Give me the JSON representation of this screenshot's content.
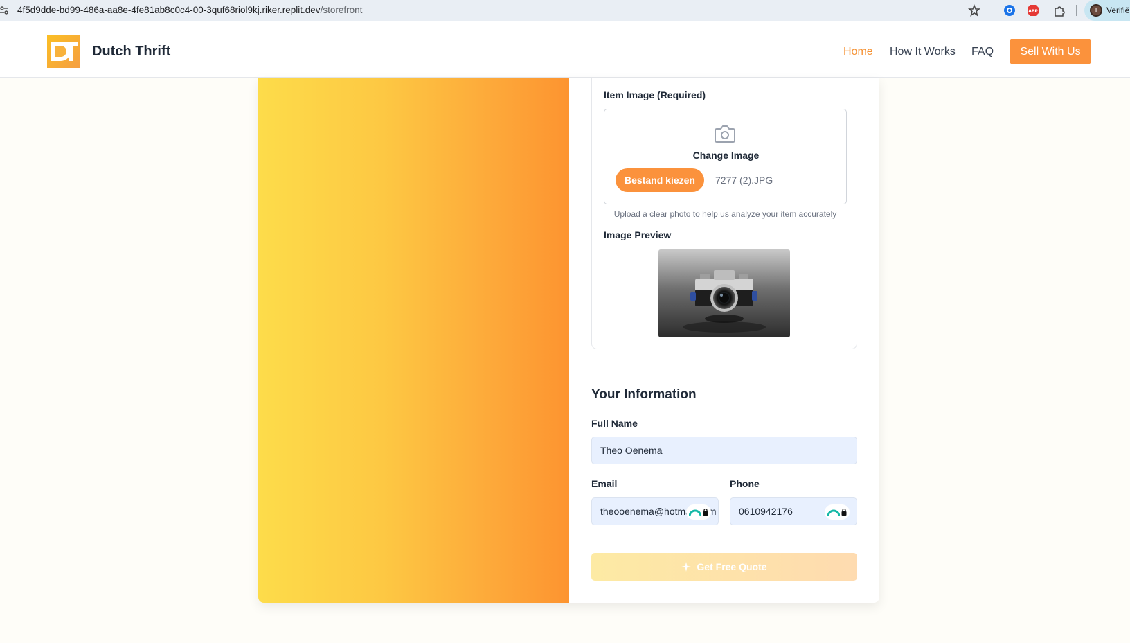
{
  "browser": {
    "url_host": "4f5d9dde-bd99-486a-aa8e-4fe81ab8c0c4-00-3quf68riol9kj.riker.replit.dev",
    "url_path": "/storefront",
    "profile_initial": "T",
    "profile_label": "Verifië"
  },
  "header": {
    "logo_text": "DT",
    "brand": "Dutch Thrift",
    "nav": {
      "home": "Home",
      "how": "How It Works",
      "faq": "FAQ"
    },
    "cta": "Sell With Us"
  },
  "form": {
    "image_label": "Item Image (Required)",
    "change_image": "Change Image",
    "choose_file": "Bestand kiezen",
    "file_name": "7277 (2).JPG",
    "helper": "Upload a clear photo to help us analyze your item accurately",
    "preview_label": "Image Preview",
    "info_title": "Your Information",
    "full_name_label": "Full Name",
    "full_name_value": "Theo Oenema",
    "email_label": "Email",
    "email_value": "theooenema@hotmail.com",
    "phone_label": "Phone",
    "phone_value": "0610942176",
    "submit": "Get Free Quote"
  },
  "colors": {
    "accent": "#fb923c",
    "nav_active": "#f59234",
    "input_bg": "#e8f0fe"
  }
}
